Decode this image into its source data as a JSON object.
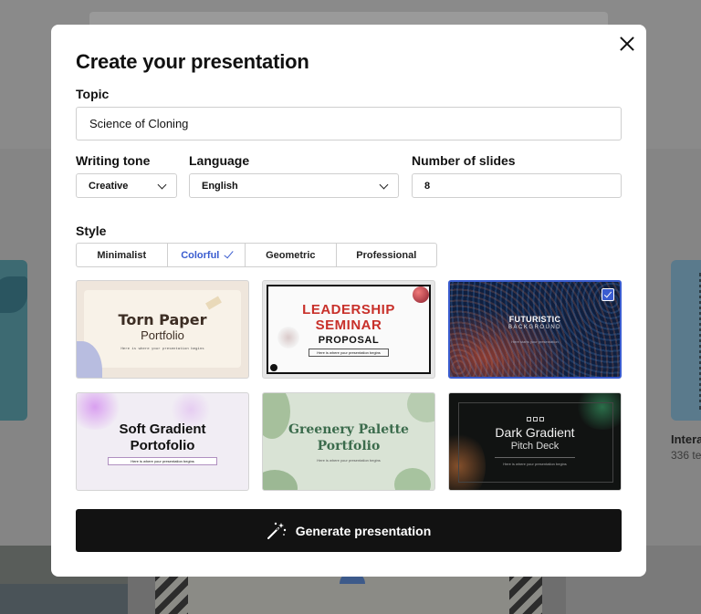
{
  "background": {
    "right_card_title": "Intera",
    "right_card_sub": "336 te"
  },
  "modal": {
    "title": "Create your presentation",
    "topic_label": "Topic",
    "topic_value": "Science of Cloning",
    "tone_label": "Writing tone",
    "tone_value": "Creative",
    "language_label": "Language",
    "language_value": "English",
    "slides_label": "Number of slides",
    "slides_value": "8",
    "style_label": "Style",
    "style_tabs": [
      {
        "label": "Minimalist",
        "active": false
      },
      {
        "label": "Colorful",
        "active": true
      },
      {
        "label": "Geometric",
        "active": false
      },
      {
        "label": "Professional",
        "active": false
      }
    ],
    "templates": [
      {
        "title": "Torn Paper",
        "subtitle": "Portfolio",
        "caption": "Here is where your presentation begins"
      },
      {
        "title": "LEADERSHIP SEMINAR",
        "subtitle": "PROPOSAL",
        "caption": "Here is where your presentation begins"
      },
      {
        "title": "FUTURISTIC",
        "subtitle": "BACKGROUND",
        "caption": "Here starts your presentation",
        "selected": true
      },
      {
        "title": "Soft Gradient Portofolio",
        "caption": "Here is where your presentation begins"
      },
      {
        "title": "Greenery Palette Portfolio",
        "caption": "Here is where your presentation begins"
      },
      {
        "title": "Dark Gradient",
        "subtitle": "Pitch Deck",
        "caption": "Here is where your presentation begins"
      }
    ],
    "generate_label": "Generate presentation"
  },
  "colors": {
    "accent": "#3a5ccf",
    "button_bg": "#121212"
  },
  "icons": [
    "close-icon",
    "chevron-down-icon",
    "check-icon",
    "magic-wand-icon"
  ]
}
